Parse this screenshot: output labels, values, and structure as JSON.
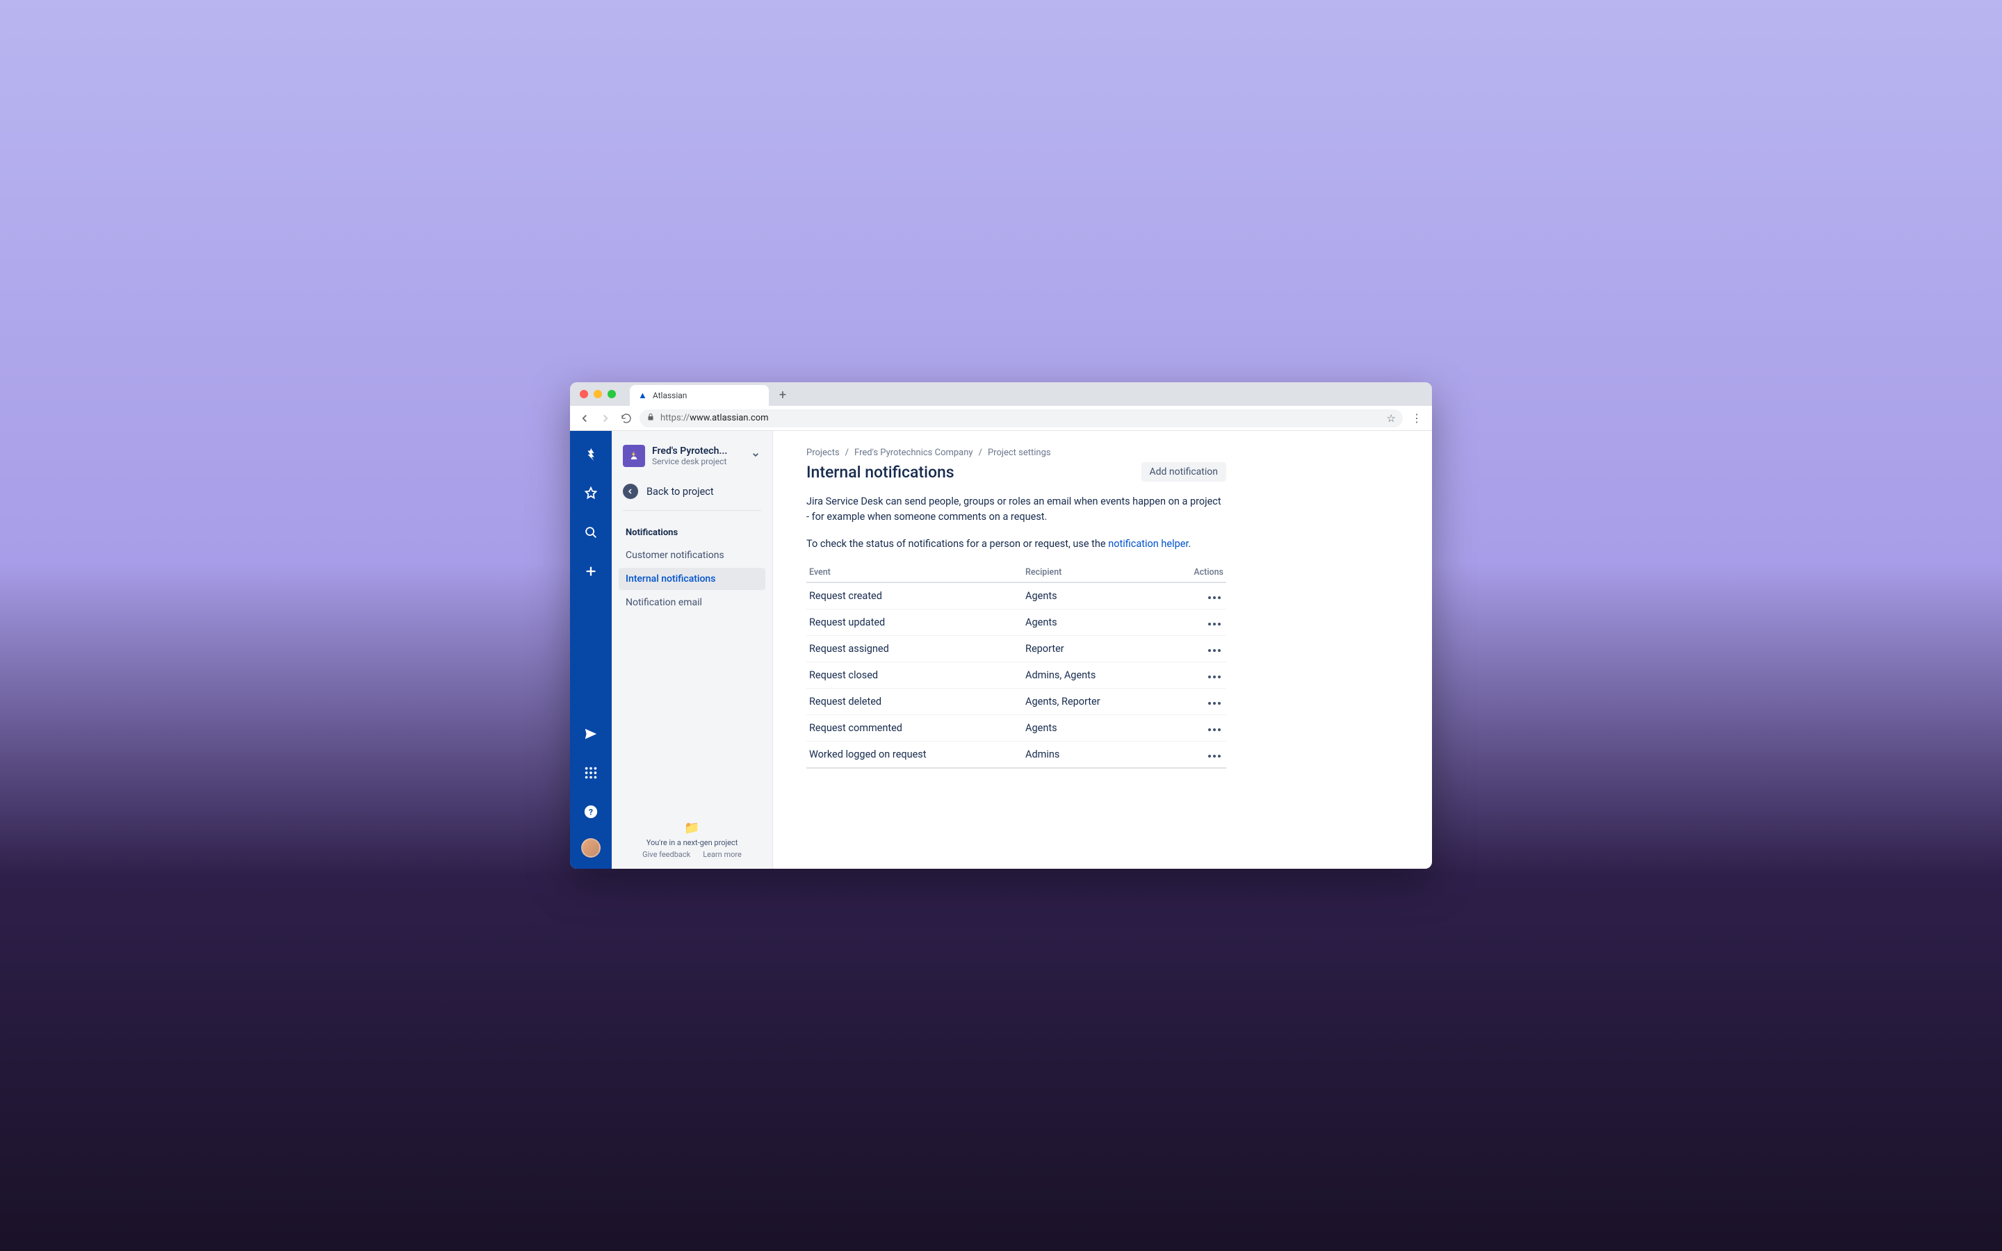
{
  "browser": {
    "tab_title": "Atlassian",
    "url_protocol": "https://",
    "url_host": "www.atlassian.com"
  },
  "sidebar": {
    "project_name": "Fred's Pyrotech...",
    "project_subtitle": "Service desk project",
    "back_label": "Back to project",
    "section_title": "Notifications",
    "items": [
      {
        "label": "Customer notifications"
      },
      {
        "label": "Internal notifications"
      },
      {
        "label": "Notification email"
      }
    ],
    "footer_note": "You're in a next-gen project",
    "feedback_label": "Give feedback",
    "learn_more_label": "Learn more"
  },
  "breadcrumbs": [
    "Projects",
    "Fred's Pyrotechnics Company",
    "Project settings"
  ],
  "page": {
    "title": "Internal notifications",
    "add_button": "Add notification",
    "intro": "Jira Service Desk can send people, groups or roles an email when events happen on a project - for example when someone comments on a request.",
    "helper_prefix": "To check the status of notifications for a person or request, use the ",
    "helper_link": "notification helper",
    "helper_suffix": "."
  },
  "table": {
    "headers": {
      "event": "Event",
      "recipient": "Recipient",
      "actions": "Actions"
    },
    "rows": [
      {
        "event": "Request created",
        "recipient": "Agents"
      },
      {
        "event": "Request updated",
        "recipient": "Agents"
      },
      {
        "event": "Request assigned",
        "recipient": "Reporter"
      },
      {
        "event": "Request closed",
        "recipient": "Admins, Agents"
      },
      {
        "event": "Request deleted",
        "recipient": "Agents, Reporter"
      },
      {
        "event": "Request commented",
        "recipient": "Agents"
      },
      {
        "event": "Worked logged on request",
        "recipient": "Admins"
      }
    ]
  }
}
